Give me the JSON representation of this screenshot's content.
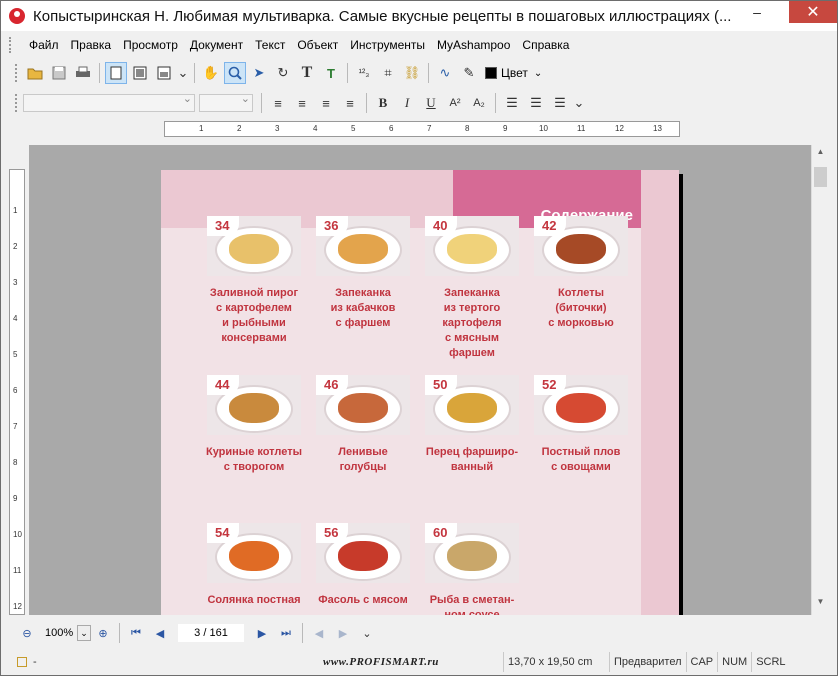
{
  "window": {
    "title": "Копыстыринская Н. Любимая мультиварка. Самые вкусные рецепты в пошаговых иллюстрациях (...",
    "min": "–",
    "close": "✕"
  },
  "menu": [
    "Файл",
    "Правка",
    "Просмотр",
    "Документ",
    "Текст",
    "Объект",
    "Инструменты",
    "MyAshampoo",
    "Справка"
  ],
  "toolbar": {
    "color_label": "Цвет"
  },
  "ruler_h": [
    "1",
    "2",
    "3",
    "4",
    "5",
    "6",
    "7",
    "8",
    "9",
    "10",
    "11",
    "12",
    "13"
  ],
  "ruler_v": [
    "1",
    "2",
    "3",
    "4",
    "5",
    "6",
    "7",
    "8",
    "9",
    "10",
    "11",
    "12"
  ],
  "page": {
    "heading": "Содержание",
    "items": [
      {
        "num": "34",
        "caption": "Заливной пирог\nс картофелем\nи рыбными\nконсервами",
        "food": "#e8c16a"
      },
      {
        "num": "36",
        "caption": "Запеканка\nиз кабачков\nс фаршем",
        "food": "#e3a44c"
      },
      {
        "num": "40",
        "caption": "Запеканка\nиз тертого\nкартофеля\nс мясным\nфаршем",
        "food": "#f0d27a"
      },
      {
        "num": "42",
        "caption": "Котлеты\n(биточки)\nс морковью",
        "food": "#a64a26"
      },
      {
        "num": "44",
        "caption": "Куриные котлеты\nс творогом",
        "food": "#c98a3d"
      },
      {
        "num": "46",
        "caption": "Ленивые\nголубцы",
        "food": "#c7683b"
      },
      {
        "num": "50",
        "caption": "Перец фарширо-\nванный",
        "food": "#d9a53a"
      },
      {
        "num": "52",
        "caption": "Постный плов\nс овощами",
        "food": "#d64a32"
      },
      {
        "num": "54",
        "caption": "Солянка постная",
        "food": "#e06b25"
      },
      {
        "num": "56",
        "caption": "Фасоль с мясом",
        "food": "#c73a2a"
      },
      {
        "num": "60",
        "caption": "Рыба в сметан-\nном соусе",
        "food": "#c9a76a"
      }
    ]
  },
  "nav": {
    "zoom": "100%",
    "page": "3 / 161"
  },
  "status": {
    "left": "-",
    "watermark": "www.PROFISMART.ru",
    "size": "13,70 x 19,50 cm",
    "mode": "Предварител",
    "cap": "CAP",
    "num": "NUM",
    "scrl": "SCRL"
  }
}
